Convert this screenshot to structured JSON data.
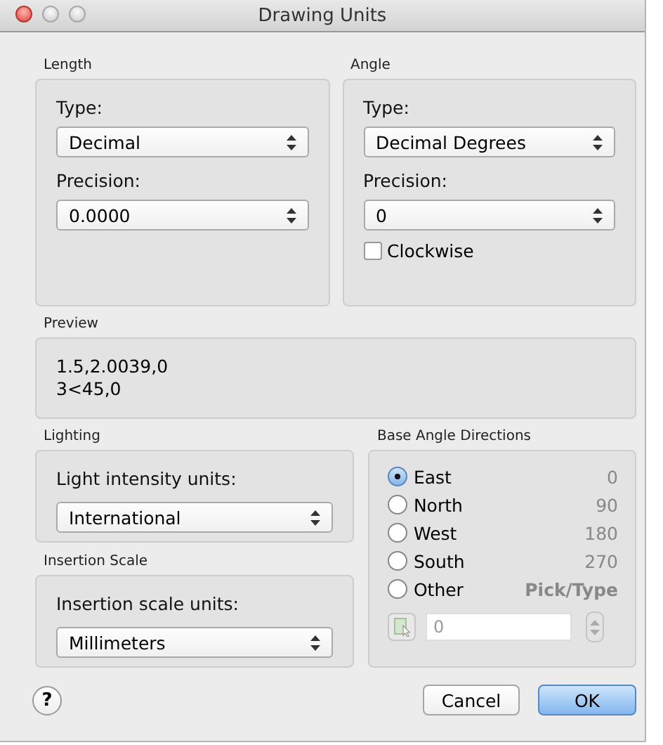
{
  "window": {
    "title": "Drawing Units"
  },
  "length": {
    "title": "Length",
    "type_label": "Type:",
    "type_value": "Decimal",
    "precision_label": "Precision:",
    "precision_value": "0.0000"
  },
  "angle": {
    "title": "Angle",
    "type_label": "Type:",
    "type_value": "Decimal Degrees",
    "precision_label": "Precision:",
    "precision_value": "0",
    "clockwise": {
      "label": "Clockwise",
      "checked": false
    }
  },
  "preview": {
    "title": "Preview",
    "lines": [
      "1.5,2.0039,0",
      "3<45,0"
    ]
  },
  "lighting": {
    "title": "Lighting",
    "label": "Light intensity units:",
    "value": "International"
  },
  "insertion_scale": {
    "title": "Insertion Scale",
    "label": "Insertion scale units:",
    "value": "Millimeters"
  },
  "base_angle": {
    "title": "Base Angle Directions",
    "directions": [
      {
        "label": "East",
        "value": "0",
        "selected": true
      },
      {
        "label": "North",
        "value": "90",
        "selected": false
      },
      {
        "label": "West",
        "value": "180",
        "selected": false
      },
      {
        "label": "South",
        "value": "270",
        "selected": false
      },
      {
        "label": "Other",
        "value": "Pick/Type",
        "selected": false
      }
    ],
    "angle_input": {
      "value": "0",
      "disabled": true
    }
  },
  "help": "?",
  "buttons": [
    {
      "label": "Cancel",
      "default": false
    },
    {
      "label": "OK",
      "default": true
    }
  ]
}
